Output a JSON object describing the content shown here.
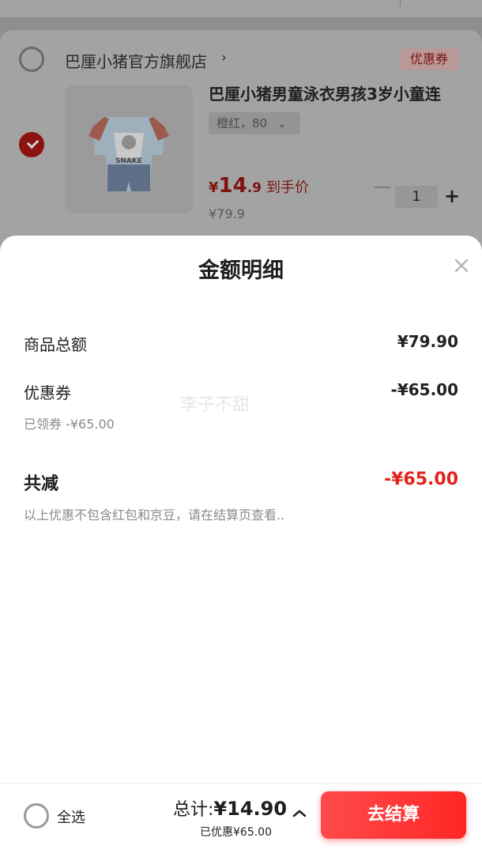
{
  "cart": {
    "shop_name": "巴厘小猪官方旗舰店",
    "shop_arrow": "›",
    "coupon_tag": "优惠券",
    "product": {
      "title": "巴厘小猪男童泳衣男孩3岁小童连",
      "variant": "橙红，80",
      "variant_chevron": "⌄",
      "price_currency": "¥",
      "price_integer": "14",
      "price_decimal": ".9",
      "price_tag": "到手价",
      "original_price": "¥79.9",
      "quantity": "1",
      "plus_label": "+",
      "image_text": "SNAKE"
    }
  },
  "sheet": {
    "title": "金额明细",
    "rows": [
      {
        "label": "商品总额",
        "value": "¥79.90"
      },
      {
        "label": "优惠券",
        "value": "-¥65.00",
        "sub": "已领券 -¥65.00"
      }
    ],
    "total_label": "共减",
    "total_value": "-¥65.00",
    "note": "以上优惠不包含红包和京豆，请在结算页查看..",
    "watermark": "李子不甜"
  },
  "footer": {
    "select_all": "全选",
    "total_prefix": "总计:",
    "total_amount": "¥14.90",
    "saved": "已优惠¥65.00",
    "checkout": "去结算"
  },
  "colors": {
    "accent": "#e2231a",
    "checkout_gradient": [
      "#ff4a4a",
      "#ff2626"
    ]
  }
}
